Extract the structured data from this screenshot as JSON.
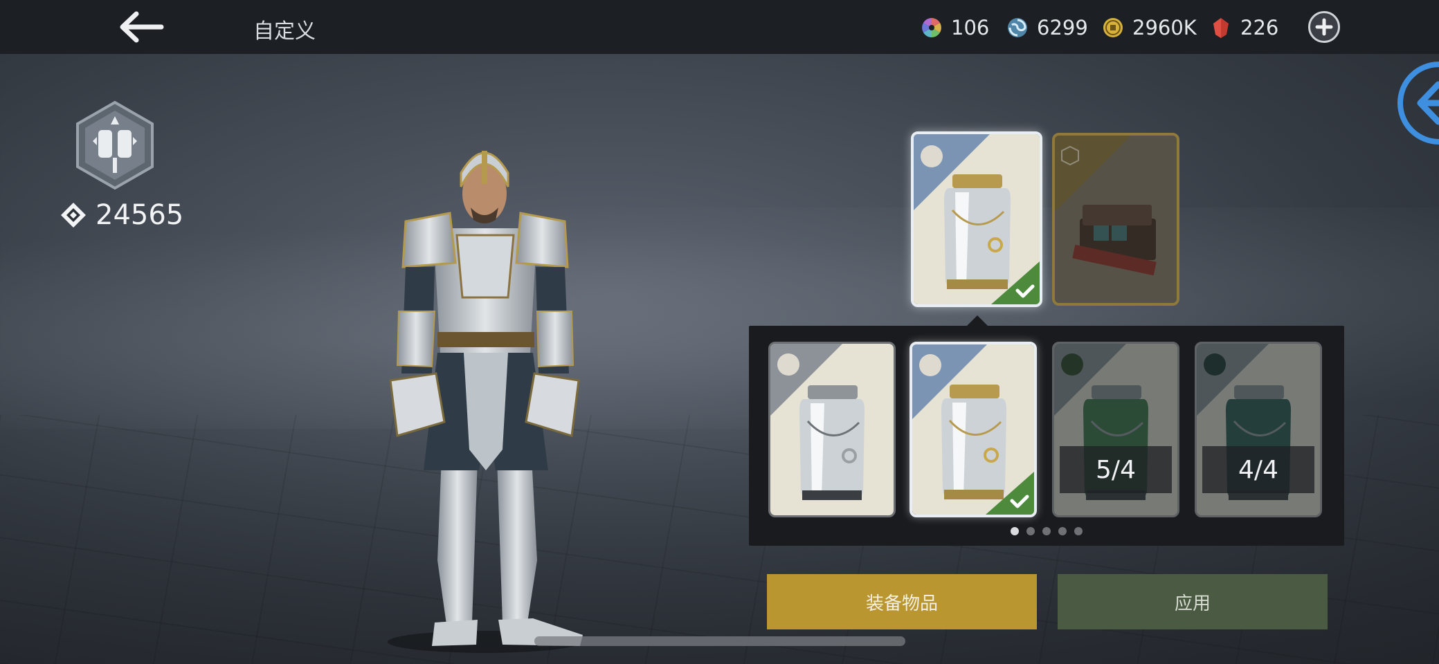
{
  "header": {
    "title": "自定义",
    "currencies": [
      {
        "name": "color-wheel-currency",
        "value": "106"
      },
      {
        "name": "swirl-currency",
        "value": "6299"
      },
      {
        "name": "gold-coin-currency",
        "value": "2960K"
      },
      {
        "name": "red-gem-currency",
        "value": "226"
      }
    ]
  },
  "player": {
    "power": "24565"
  },
  "items": {
    "option_counts": [
      "5/4",
      "4/4"
    ]
  },
  "pagination": {
    "pages": 5,
    "current": 1
  },
  "buttons": {
    "equip_label": "装备物品",
    "apply_label": "应用"
  },
  "colors": {
    "topbar": "#1c1f23",
    "equip_button": "#b9962f",
    "apply_button": "#4b5a42",
    "selected_border": "#e8eef4",
    "check_green": "#4e8a3c",
    "side_arrow_blue": "#3f8fe0"
  }
}
